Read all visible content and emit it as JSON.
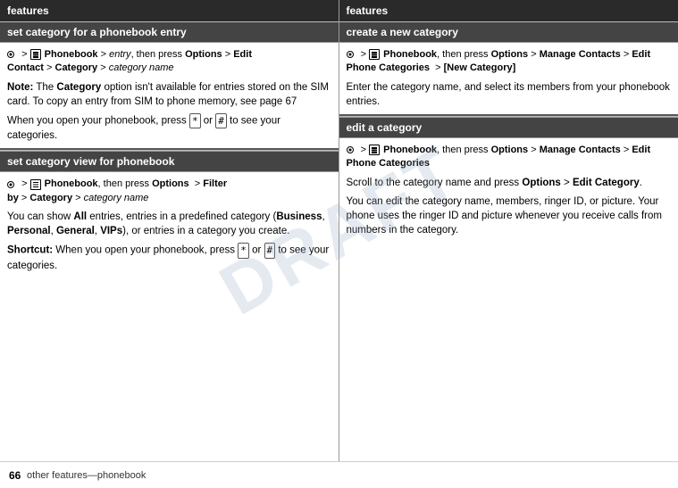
{
  "page": {
    "footer": {
      "page_number": "66",
      "text": "other features—phonebook"
    }
  },
  "left_column": {
    "header": "features",
    "sections": [
      {
        "id": "set-category-entry",
        "subheader": "set category for a phonebook entry",
        "nav_line": "· > Phonebook > entry, then press Options > Edit Contact > Category > category name",
        "paragraphs": [
          "Note: The Category option isn't available for entries stored on the SIM card. To copy an entry from SIM to phone memory, see page 67",
          "When you open your phonebook, press * or # to see your categories."
        ]
      },
      {
        "id": "set-category-view",
        "subheader": "set category view for phonebook",
        "nav_line": "· > Phonebook, then press Options > Filter by > Category > category name",
        "paragraphs": [
          "You can show All entries, entries in a predefined category (Business, Personal, General, VIPs), or entries in a category you create.",
          "Shortcut: When you open your phonebook, press * or # to see your categories."
        ]
      }
    ]
  },
  "right_column": {
    "header": "features",
    "sections": [
      {
        "id": "create-category",
        "subheader": "create a new category",
        "nav_line": "· > Phonebook, then press Options > Manage Contacts > Edit Phone Categories > [New Category]",
        "paragraphs": [
          "Enter the category name, and select its members from your phonebook entries."
        ]
      },
      {
        "id": "edit-category",
        "subheader": "edit a category",
        "nav_line": "· > Phonebook, then press Options > Manage Contacts > Edit Phone Categories",
        "paragraphs": [
          "Scroll to the category name and press Options > Edit Category.",
          "You can edit the category name, members, ringer ID, or picture. Your phone uses the ringer ID and picture whenever you receive calls from numbers in the category."
        ]
      }
    ]
  }
}
